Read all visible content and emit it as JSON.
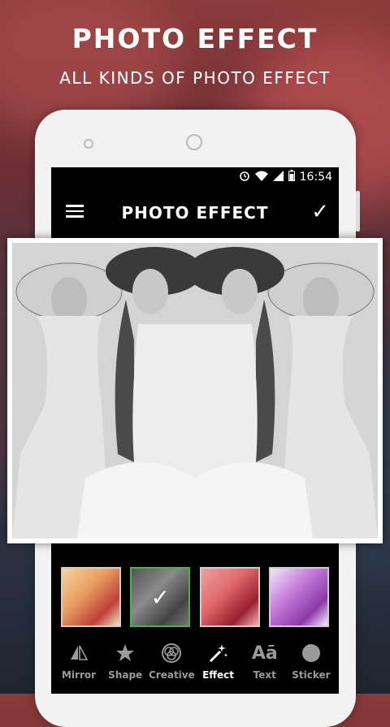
{
  "promo": {
    "title": "PHOTO EFFECT",
    "subtitle": "ALL KINDS OF PHOTO EFFECT"
  },
  "status_bar": {
    "time": "16:54",
    "icons": [
      "alarm-icon",
      "wifi-icon",
      "signal-icon",
      "battery-icon"
    ]
  },
  "app_bar": {
    "title": "PHOTO EFFECT",
    "menu_icon": "hamburger-menu-icon",
    "confirm_icon": "checkmark-icon"
  },
  "photo": {
    "description_icon": "mirrored-photo"
  },
  "thumbnails": [
    {
      "effect": "warm",
      "selected": false,
      "tint": "#e8a060"
    },
    {
      "effect": "grayscale",
      "selected": true,
      "tint": "#777777"
    },
    {
      "effect": "red",
      "selected": false,
      "tint": "#e06a6a"
    },
    {
      "effect": "purple",
      "selected": false,
      "tint": "#c47ad8"
    }
  ],
  "tabs": [
    {
      "label": "Mirror",
      "icon": "mirror-icon",
      "active": false
    },
    {
      "label": "Shape",
      "icon": "star-icon",
      "active": false
    },
    {
      "label": "Creative",
      "icon": "creative-icon",
      "active": false
    },
    {
      "label": "Effect",
      "icon": "magic-wand-icon",
      "active": true
    },
    {
      "label": "Text",
      "icon": "text-icon",
      "active": false
    },
    {
      "label": "Sticker",
      "icon": "sticker-icon",
      "active": false
    }
  ],
  "colors": {
    "selected_border": "#4caf50",
    "active_tab": "#ffffff",
    "inactive_tab": "#9a9a9a"
  }
}
